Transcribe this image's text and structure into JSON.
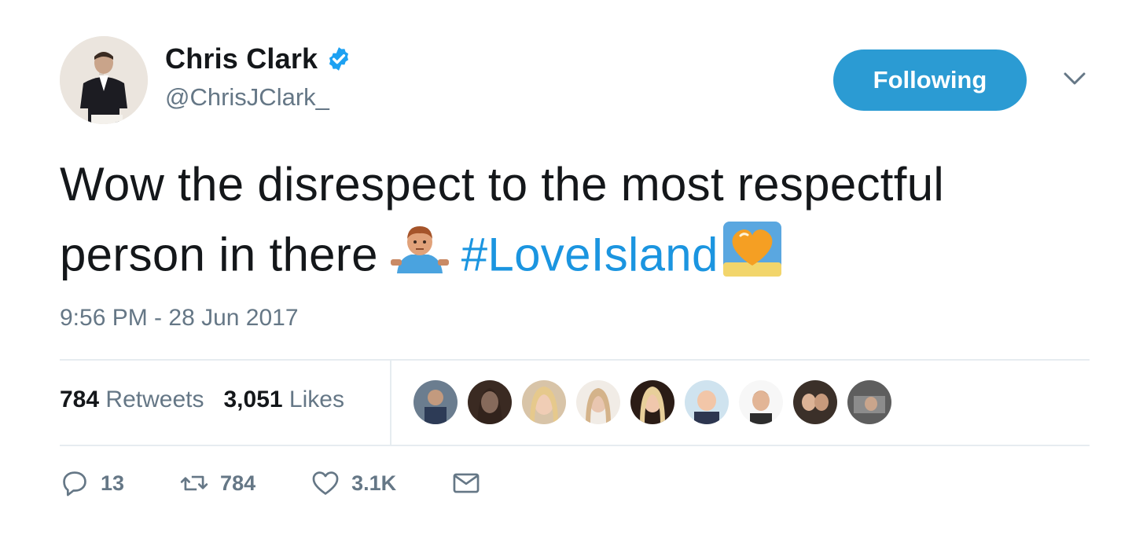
{
  "tweet": {
    "author": {
      "name": "Chris Clark",
      "handle": "@ChrisJClark_",
      "verified": true,
      "avatar_icon": "profile-photo"
    },
    "follow_button_label": "Following",
    "menu_icon": "chevron-down-icon",
    "text_line1": "Wow the disrespect to the most respectful",
    "text_line2_prefix": "person in there",
    "emoji1": "person-shrugging-emoji",
    "hashtag": "#LoveIsland",
    "emoji2": "orange-heart-emoji",
    "timestamp": "9:56 PM - 28 Jun 2017",
    "stats": {
      "retweets_count": "784",
      "retweets_label": "Retweets",
      "likes_count": "3,051",
      "likes_label": "Likes"
    },
    "likers_count_shown": 9,
    "actions": {
      "reply_count": "13",
      "retweet_count": "784",
      "like_count": "3.1K"
    },
    "colors": {
      "accent": "#1b95e0",
      "follow_button": "#2b9bd3",
      "muted_text": "#657786",
      "divider": "#e6ecf0"
    }
  }
}
